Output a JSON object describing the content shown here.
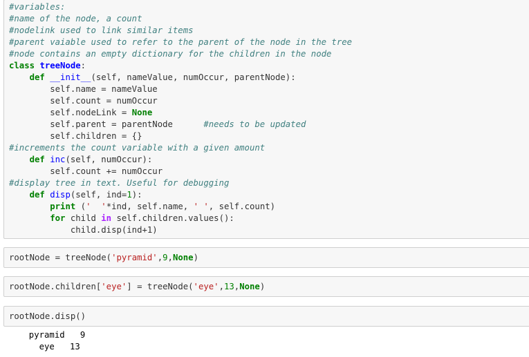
{
  "cells": [
    {
      "lines": [
        "#variables:",
        "#name of the node, a count",
        "#nodelink used to link similar items",
        "#parent vaiable used to refer to the parent of the node in the tree",
        "#node contains an empty dictionary for the children in the node",
        "class treeNode:",
        "    def __init__(self, nameValue, numOccur, parentNode):",
        "        self.name = nameValue",
        "        self.count = numOccur",
        "        self.nodeLink = None",
        "        self.parent = parentNode      #needs to be updated",
        "        self.children = {}",
        "#increments the count variable with a given amount",
        "    def inc(self, numOccur):",
        "        self.count += numOccur",
        "#display tree in text. Useful for debugging",
        "    def disp(self, ind=1):",
        "        print ('  '*ind, self.name, ' ', self.count)",
        "        for child in self.children.values():",
        "            child.disp(ind+1)"
      ]
    },
    {
      "lines": [
        "rootNode = treeNode('pyramid',9,None)"
      ]
    },
    {
      "lines": [
        "rootNode.children['eye'] = treeNode('eye',13,None)"
      ]
    },
    {
      "lines": [
        "rootNode.disp()"
      ]
    }
  ],
  "output": {
    "lines": [
      "  pyramid   9",
      "    eye   13"
    ]
  }
}
